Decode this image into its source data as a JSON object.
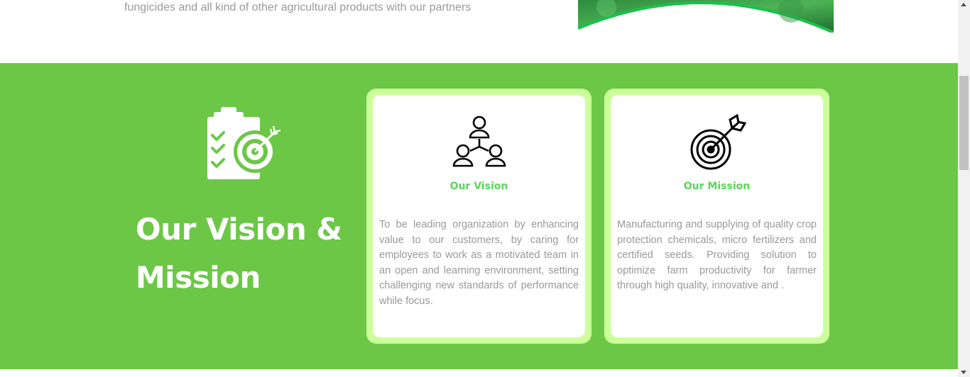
{
  "intro": {
    "text": "fungicides and all kind of other agricultural products with our partners"
  },
  "colors": {
    "section_bg": "#6cc747",
    "card_border": "#ccff99",
    "card_title": "#5bd55b",
    "body_text": "#999999",
    "heading": "#ffffff"
  },
  "section": {
    "heading": "Our Vision & Mission",
    "heading_icon": "clipboard-target-icon"
  },
  "cards": [
    {
      "icon": "team-network-icon",
      "title": "Our Vision",
      "text": "To be leading organization by enhancing value to our customers, by caring for employees to work as a motivated team in an open and learning environment, setting challenging new standards of performance while focus."
    },
    {
      "icon": "target-arrow-icon",
      "title": "Our Mission",
      "text": "Manufacturing and supplying of quality crop protection chemicals, micro fertilizers and certified seeds. Providing solution to optimize farm productivity for farmer through high quality, innovative and ."
    }
  ]
}
